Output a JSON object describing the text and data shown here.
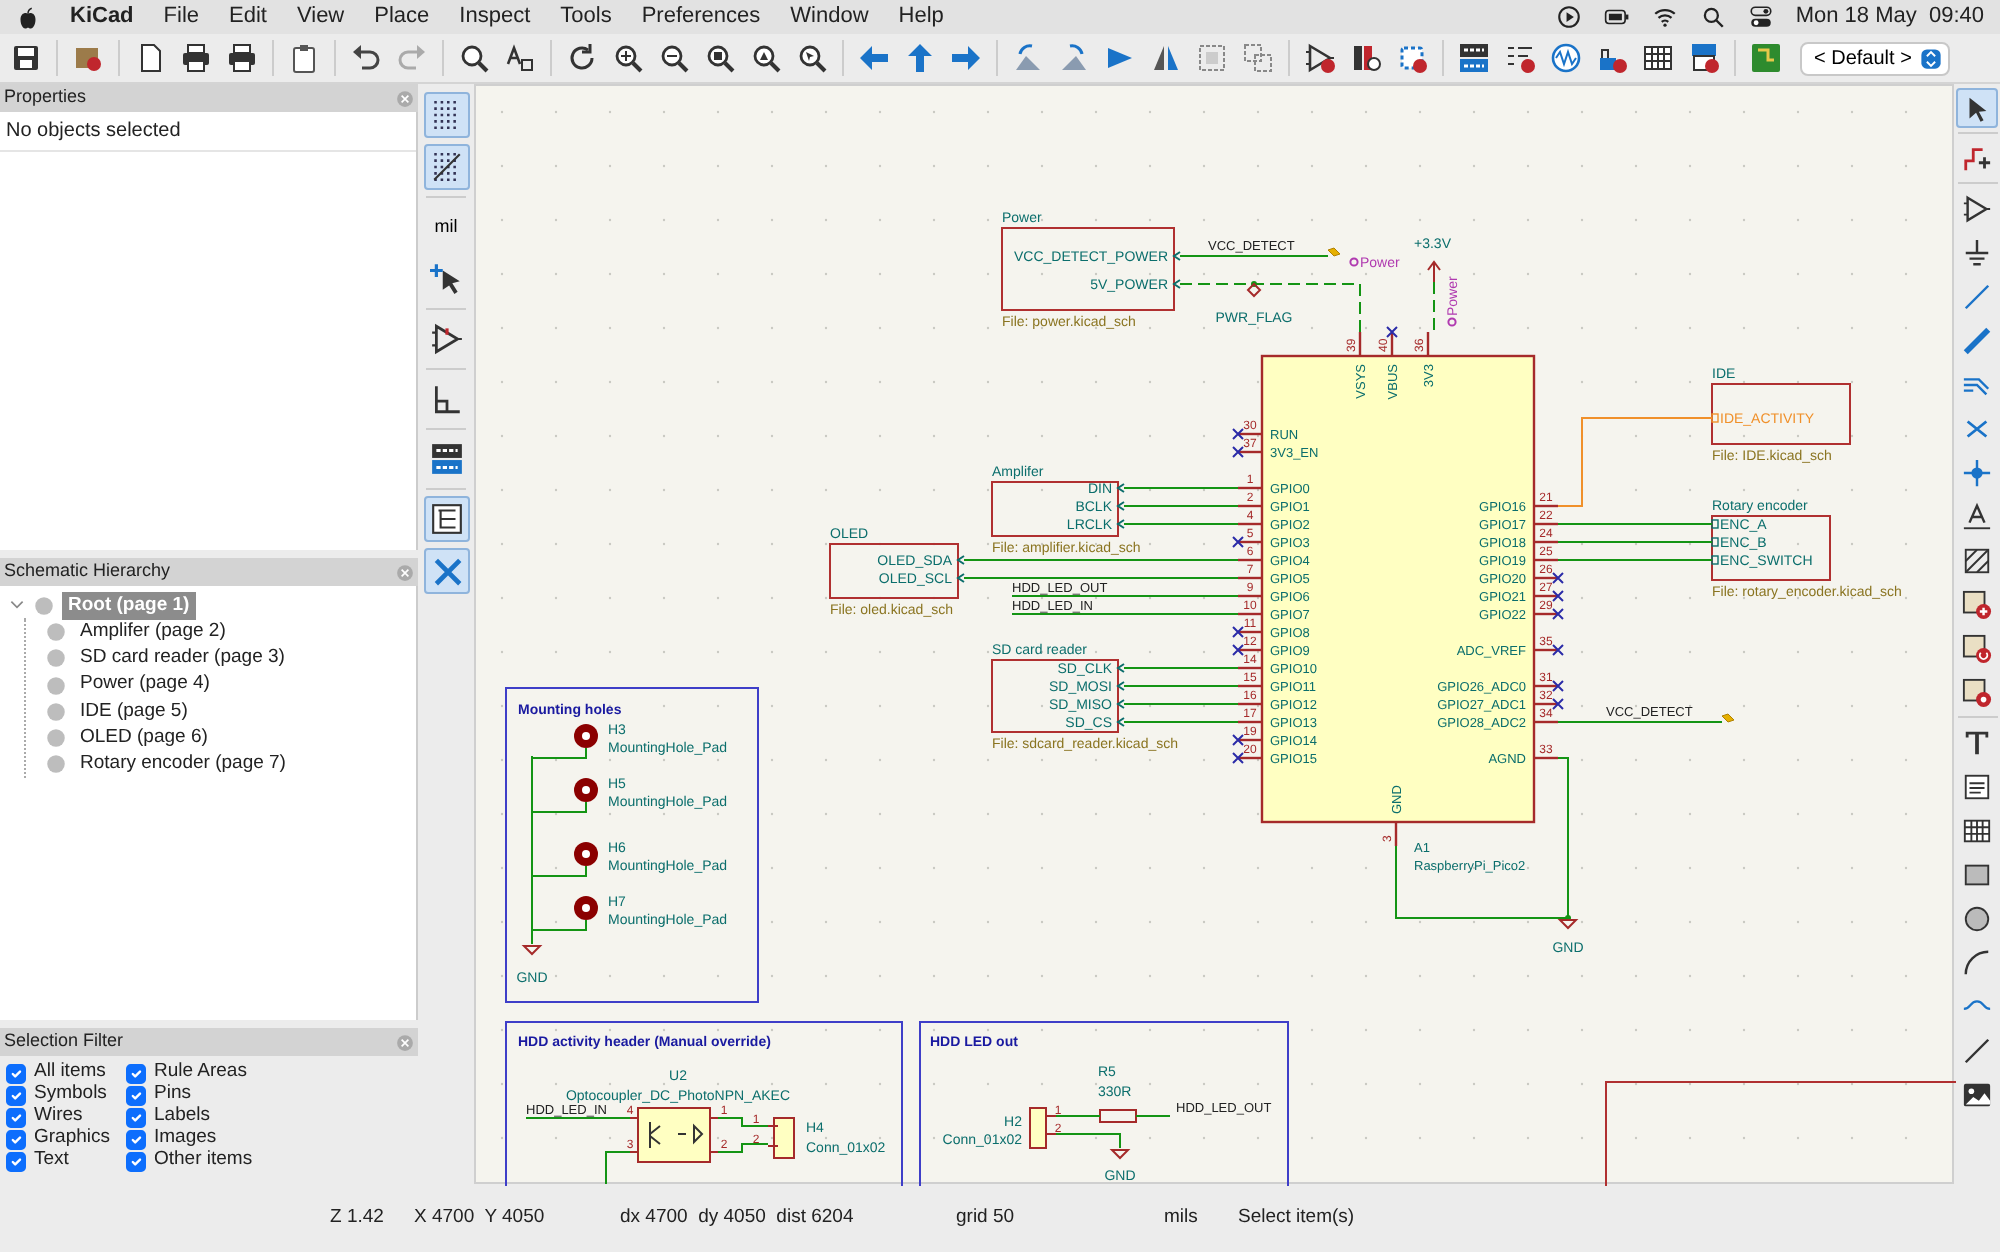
{
  "menubar": {
    "app": "KiCad",
    "menus": [
      "File",
      "Edit",
      "View",
      "Place",
      "Inspect",
      "Tools",
      "Preferences",
      "Window",
      "Help"
    ],
    "clock": "Mon 18 May  09:40"
  },
  "toolbar": {
    "viewport": "< Default >"
  },
  "left_toolbar": [
    {
      "kind": "grid",
      "on": true
    },
    {
      "kind": "grid_overlay",
      "on": true
    },
    {
      "kind": "units",
      "label": "mil",
      "on": false
    },
    {
      "kind": "cursor",
      "on": false
    },
    {
      "kind": "pin_check",
      "on": false
    },
    {
      "kind": "angle",
      "on": false
    },
    {
      "kind": "annotate",
      "on": false
    },
    {
      "kind": "hierarchy",
      "on": true
    },
    {
      "kind": "properties",
      "on": true
    }
  ],
  "properties": {
    "title": "Properties",
    "message": "No objects selected"
  },
  "hierarchy": {
    "title": "Schematic Hierarchy",
    "root": {
      "label": "Root (page 1)",
      "selected": true,
      "expanded": true,
      "children": [
        {
          "label": "Amplifer (page 2)",
          "selected": false
        },
        {
          "label": "SD card reader (page 3)",
          "selected": false
        },
        {
          "label": "Power (page 4)",
          "selected": false
        },
        {
          "label": "IDE (page 5)",
          "selected": false
        },
        {
          "label": "OLED (page 6)",
          "selected": false
        },
        {
          "label": "Rotary encoder (page 7)",
          "selected": false
        }
      ]
    }
  },
  "selection_filter": {
    "title": "Selection Filter",
    "items": [
      {
        "label": "All items",
        "checked": true
      },
      {
        "label": "Rule Areas",
        "checked": true
      },
      {
        "label": "Symbols",
        "checked": true
      },
      {
        "label": "Pins",
        "checked": true
      },
      {
        "label": "Wires",
        "checked": true
      },
      {
        "label": "Labels",
        "checked": true
      },
      {
        "label": "Graphics",
        "checked": true
      },
      {
        "label": "Images",
        "checked": true
      },
      {
        "label": "Text",
        "checked": true
      },
      {
        "label": "Other items",
        "checked": true
      }
    ]
  },
  "schematic": {
    "sheets": [
      {
        "title": "Power",
        "file": "File: power.kicad_sch",
        "pins": [
          "VCC_DETECT_POWER",
          "5V_POWER"
        ],
        "highlighted": false
      },
      {
        "title": "Amplifer",
        "file": "File: amplifier.kicad_sch",
        "pins": [
          "DIN",
          "BCLK",
          "LRCLK"
        ],
        "highlighted": false
      },
      {
        "title": "OLED",
        "file": "File: oled.kicad_sch",
        "pins": [
          "OLED_SDA",
          "OLED_SCL"
        ],
        "highlighted": false
      },
      {
        "title": "SD card reader",
        "file": "File: sdcard_reader.kicad_sch",
        "pins": [
          "SD_CLK",
          "SD_MOSI",
          "SD_MISO",
          "SD_CS"
        ],
        "highlighted": false
      },
      {
        "title": "IDE",
        "file": "File: IDE.kicad_sch",
        "pins": [
          "IDE_ACTIVITY"
        ],
        "highlighted": true
      },
      {
        "title": "Rotary encoder",
        "file": "File: rotary_encoder.kicad_sch",
        "pins": [
          "ENC_A",
          "ENC_B",
          "ENC_SWITCH"
        ],
        "highlighted": false
      }
    ],
    "symbol": {
      "ref": "A1",
      "value": "RaspberryPi_Pico2",
      "top_pins": [
        {
          "num": "39",
          "name": "VSYS",
          "nc": false
        },
        {
          "num": "40",
          "name": "VBUS",
          "nc": true
        },
        {
          "num": "36",
          "name": "3V3",
          "nc": false
        }
      ],
      "left_pins": [
        {
          "num": "30",
          "name": "RUN",
          "nc": true
        },
        {
          "num": "37",
          "name": "3V3_EN",
          "nc": true
        },
        {
          "num": "1",
          "name": "GPIO0",
          "nc": false
        },
        {
          "num": "2",
          "name": "GPIO1",
          "nc": false
        },
        {
          "num": "4",
          "name": "GPIO2",
          "nc": false
        },
        {
          "num": "5",
          "name": "GPIO3",
          "nc": true
        },
        {
          "num": "6",
          "name": "GPIO4",
          "nc": false
        },
        {
          "num": "7",
          "name": "GPIO5",
          "nc": false
        },
        {
          "num": "9",
          "name": "GPIO6",
          "nc": false
        },
        {
          "num": "10",
          "name": "GPIO7",
          "nc": false
        },
        {
          "num": "11",
          "name": "GPIO8",
          "nc": true
        },
        {
          "num": "12",
          "name": "GPIO9",
          "nc": true
        },
        {
          "num": "14",
          "name": "GPIO10",
          "nc": false
        },
        {
          "num": "15",
          "name": "GPIO11",
          "nc": false
        },
        {
          "num": "16",
          "name": "GPIO12",
          "nc": false
        },
        {
          "num": "17",
          "name": "GPIO13",
          "nc": false
        },
        {
          "num": "19",
          "name": "GPIO14",
          "nc": true
        },
        {
          "num": "20",
          "name": "GPIO15",
          "nc": true
        }
      ],
      "right_pins": [
        {
          "num": "21",
          "name": "GPIO16",
          "nc": false
        },
        {
          "num": "22",
          "name": "GPIO17",
          "nc": false
        },
        {
          "num": "24",
          "name": "GPIO18",
          "nc": false
        },
        {
          "num": "25",
          "name": "GPIO19",
          "nc": false
        },
        {
          "num": "26",
          "name": "GPIO20",
          "nc": true
        },
        {
          "num": "27",
          "name": "GPIO21",
          "nc": true
        },
        {
          "num": "29",
          "name": "GPIO22",
          "nc": true
        },
        {
          "num": "35",
          "name": "ADC_VREF",
          "nc": true
        },
        {
          "num": "31",
          "name": "GPIO26_ADC0",
          "nc": true
        },
        {
          "num": "32",
          "name": "GPIO27_ADC1",
          "nc": true
        },
        {
          "num": "34",
          "name": "GPIO28_ADC2",
          "nc": false
        },
        {
          "num": "33",
          "name": "AGND",
          "nc": false
        }
      ],
      "bottom_pins": [
        {
          "num": "3",
          "name": "GND",
          "nc": false
        }
      ]
    },
    "labels": [
      {
        "kind": "global",
        "text": "VCC_DETECT"
      },
      {
        "kind": "local",
        "text": "HDD_LED_OUT"
      },
      {
        "kind": "local",
        "text": "HDD_LED_IN"
      },
      {
        "kind": "global",
        "text": "VCC_DETECT"
      }
    ],
    "power": [
      {
        "kind": "netclass",
        "text": "Power"
      },
      {
        "kind": "flag",
        "text": "PWR_FLAG"
      },
      {
        "kind": "supply",
        "text": "+3.3V"
      },
      {
        "kind": "netclass",
        "text": "Power"
      },
      {
        "kind": "ground",
        "text": "GND"
      }
    ],
    "groups": [
      {
        "kind": "mounting_holes",
        "title": "Mounting holes",
        "holes": [
          {
            "ref": "H3",
            "value": "MountingHole_Pad"
          },
          {
            "ref": "H5",
            "value": "MountingHole_Pad"
          },
          {
            "ref": "H6",
            "value": "MountingHole_Pad"
          },
          {
            "ref": "H7",
            "value": "MountingHole_Pad"
          }
        ],
        "ground": "GND"
      },
      {
        "kind": "hdd_header",
        "title": "HDD activity header (Manual override)",
        "u_ref": "U2",
        "u_value": "Optocoupler_DC_PhotoNPN_AKEC",
        "net": "HDD_LED_IN",
        "u_pins": [
          "4",
          "3",
          "1",
          "2"
        ],
        "conn_pins": [
          "1",
          "2"
        ],
        "conn_ref": "H4",
        "conn_value": "Conn_01x02"
      },
      {
        "kind": "led_out",
        "title": "HDD LED out",
        "r_ref": "R5",
        "r_value": "330R",
        "conn_ref": "H2",
        "conn_value": "Conn_01x02",
        "conn_pins": [
          "1",
          "2"
        ],
        "net": "HDD_LED_OUT",
        "ground": "GND"
      }
    ]
  },
  "right_toolbar": [
    {
      "kind": "select",
      "selected": true
    },
    {
      "kind": "highlight",
      "selected": false
    },
    {
      "kind": "symbol",
      "selected": false
    },
    {
      "kind": "power",
      "selected": false
    },
    {
      "kind": "wire",
      "selected": false
    },
    {
      "kind": "bus",
      "selected": false
    },
    {
      "kind": "bus_entry",
      "selected": false
    },
    {
      "kind": "no_connect",
      "selected": false
    },
    {
      "kind": "junction",
      "selected": false
    },
    {
      "kind": "label",
      "selected": false
    },
    {
      "kind": "rule_area",
      "selected": false
    },
    {
      "kind": "sheet",
      "selected": false
    },
    {
      "kind": "import_pin",
      "selected": false
    },
    {
      "kind": "sheet_pin",
      "selected": false
    },
    {
      "kind": "text",
      "selected": false
    },
    {
      "kind": "text_box",
      "selected": false
    },
    {
      "kind": "table",
      "selected": false
    },
    {
      "kind": "rectangle",
      "selected": false
    },
    {
      "kind": "circle",
      "selected": false
    },
    {
      "kind": "arc",
      "selected": false
    },
    {
      "kind": "bezier",
      "selected": false
    },
    {
      "kind": "line",
      "selected": false
    },
    {
      "kind": "image",
      "selected": false
    }
  ],
  "status_bar": [
    "Z 1.42",
    "X 4700  Y 4050",
    "dx 4700  dy 4050  dist 6204",
    "grid 50",
    "mils",
    "Select item(s)"
  ]
}
